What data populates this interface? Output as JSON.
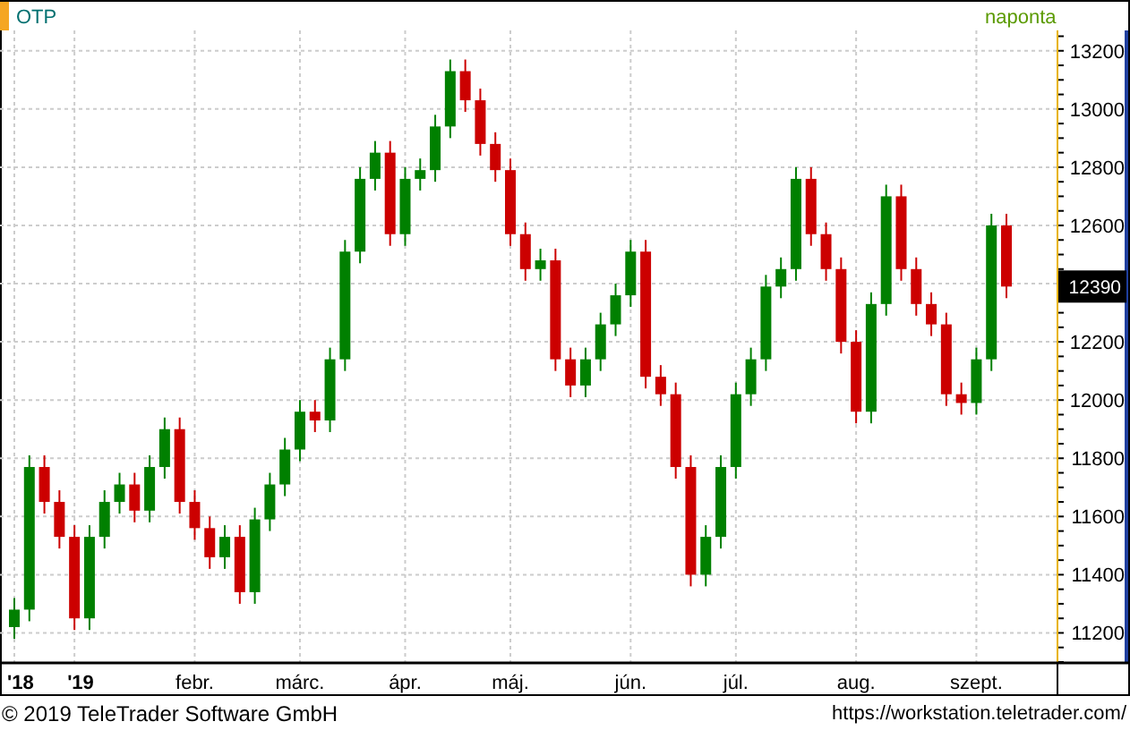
{
  "header": {
    "symbol": "OTP",
    "interval": "naponta"
  },
  "chart_data": {
    "type": "candlestick",
    "grid": true,
    "ylim": [
      11100,
      13270
    ],
    "yticks": [
      11200,
      11400,
      11600,
      11800,
      12000,
      12200,
      12600,
      12800,
      13000,
      13200
    ],
    "categories": [
      "'18",
      null,
      null,
      null,
      "'19",
      null,
      null,
      null,
      null,
      null,
      null,
      null,
      "febr.",
      null,
      null,
      null,
      null,
      null,
      null,
      "márc.",
      null,
      null,
      null,
      null,
      null,
      null,
      "ápr.",
      null,
      null,
      null,
      null,
      null,
      null,
      "máj.",
      null,
      null,
      null,
      null,
      null,
      null,
      null,
      "jún.",
      null,
      null,
      null,
      null,
      null,
      null,
      "júl.",
      null,
      null,
      null,
      null,
      null,
      null,
      null,
      "aug.",
      null,
      null,
      null,
      null,
      null,
      null,
      null,
      "szept.",
      null,
      null
    ],
    "ohlc": [
      [
        11220,
        11320,
        11180,
        11280
      ],
      [
        11280,
        11810,
        11240,
        11770
      ],
      [
        11770,
        11810,
        11610,
        11650
      ],
      [
        11650,
        11690,
        11490,
        11530
      ],
      [
        11530,
        11570,
        11210,
        11250
      ],
      [
        11250,
        11570,
        11210,
        11530
      ],
      [
        11530,
        11690,
        11490,
        11650
      ],
      [
        11650,
        11750,
        11610,
        11710
      ],
      [
        11710,
        11750,
        11580,
        11620
      ],
      [
        11620,
        11810,
        11580,
        11770
      ],
      [
        11770,
        11940,
        11730,
        11900
      ],
      [
        11900,
        11940,
        11610,
        11650
      ],
      [
        11650,
        11690,
        11520,
        11560
      ],
      [
        11560,
        11600,
        11420,
        11460
      ],
      [
        11460,
        11570,
        11420,
        11530
      ],
      [
        11530,
        11570,
        11300,
        11340
      ],
      [
        11340,
        11630,
        11300,
        11590
      ],
      [
        11590,
        11750,
        11550,
        11710
      ],
      [
        11710,
        11870,
        11670,
        11830
      ],
      [
        11830,
        12000,
        11790,
        11960
      ],
      [
        11960,
        12000,
        11890,
        11930
      ],
      [
        11930,
        12180,
        11890,
        12140
      ],
      [
        12140,
        12550,
        12100,
        12510
      ],
      [
        12510,
        12800,
        12470,
        12760
      ],
      [
        12760,
        12890,
        12720,
        12850
      ],
      [
        12850,
        12890,
        12530,
        12570
      ],
      [
        12570,
        12800,
        12530,
        12760
      ],
      [
        12760,
        12830,
        12720,
        12790
      ],
      [
        12790,
        12980,
        12750,
        12940
      ],
      [
        12940,
        13170,
        12900,
        13130
      ],
      [
        13130,
        13170,
        12990,
        13030
      ],
      [
        13030,
        13070,
        12840,
        12880
      ],
      [
        12880,
        12920,
        12750,
        12790
      ],
      [
        12790,
        12830,
        12530,
        12570
      ],
      [
        12570,
        12610,
        12410,
        12450
      ],
      [
        12450,
        12520,
        12410,
        12480
      ],
      [
        12480,
        12520,
        12100,
        12140
      ],
      [
        12140,
        12180,
        12010,
        12050
      ],
      [
        12050,
        12180,
        12010,
        12140
      ],
      [
        12140,
        12300,
        12100,
        12260
      ],
      [
        12260,
        12400,
        12220,
        12360
      ],
      [
        12360,
        12550,
        12320,
        12510
      ],
      [
        12510,
        12550,
        12040,
        12080
      ],
      [
        12080,
        12120,
        11980,
        12020
      ],
      [
        12020,
        12060,
        11730,
        11770
      ],
      [
        11770,
        11810,
        11360,
        11400
      ],
      [
        11400,
        11570,
        11360,
        11530
      ],
      [
        11530,
        11810,
        11490,
        11770
      ],
      [
        11770,
        12060,
        11730,
        12020
      ],
      [
        12020,
        12180,
        11980,
        12140
      ],
      [
        12140,
        12430,
        12100,
        12390
      ],
      [
        12390,
        12490,
        12350,
        12450
      ],
      [
        12450,
        12800,
        12410,
        12760
      ],
      [
        12760,
        12800,
        12530,
        12570
      ],
      [
        12570,
        12610,
        12410,
        12450
      ],
      [
        12450,
        12490,
        12160,
        12200
      ],
      [
        12200,
        12240,
        11920,
        11960
      ],
      [
        11960,
        12370,
        11920,
        12330
      ],
      [
        12330,
        12740,
        12290,
        12700
      ],
      [
        12700,
        12740,
        12410,
        12450
      ],
      [
        12450,
        12490,
        12290,
        12330
      ],
      [
        12330,
        12370,
        12220,
        12260
      ],
      [
        12260,
        12300,
        11980,
        12020
      ],
      [
        12020,
        12060,
        11950,
        11990
      ],
      [
        11990,
        12180,
        11950,
        12140
      ],
      [
        12140,
        12640,
        12100,
        12600
      ],
      [
        12600,
        12640,
        12350,
        12390
      ]
    ],
    "annotations": [
      "12390"
    ]
  },
  "footer": {
    "copyright": "© 2019 TeleTrader Software GmbH",
    "url": "https://workstation.teletrader.com/"
  }
}
